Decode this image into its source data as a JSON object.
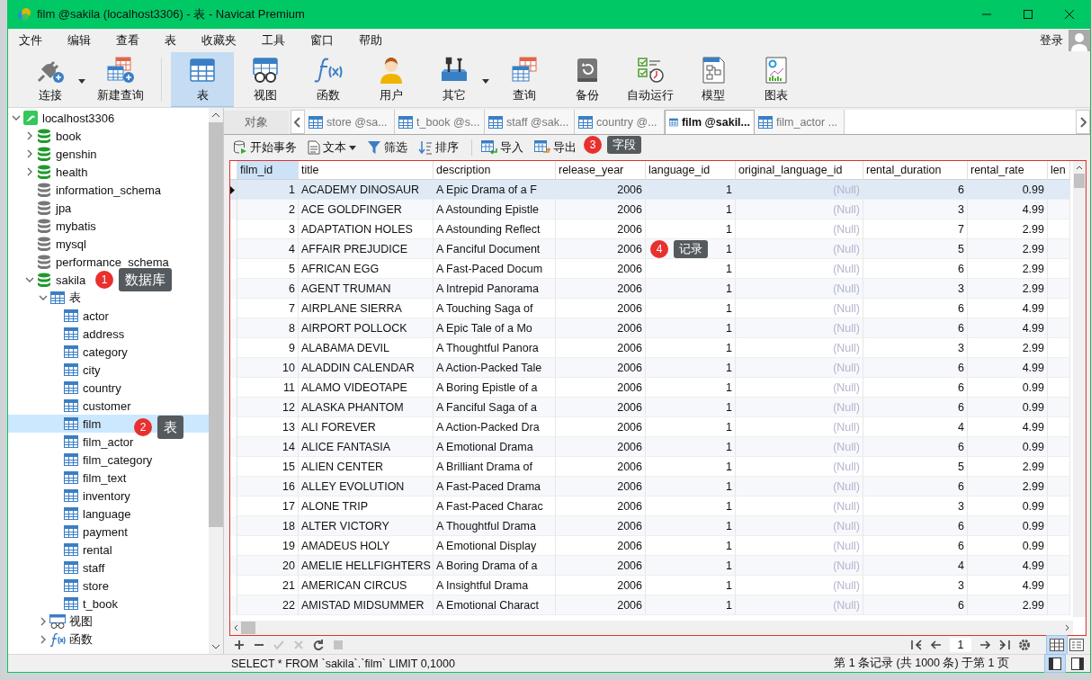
{
  "window": {
    "title": "film @sakila (localhost3306) - 表 - Navicat Premium"
  },
  "menu": [
    "文件",
    "编辑",
    "查看",
    "表",
    "收藏夹",
    "工具",
    "窗口",
    "帮助"
  ],
  "login": "登录",
  "toolbar": [
    {
      "label": "连接",
      "dropdown": true,
      "selected": false
    },
    {
      "label": "新建查询",
      "dropdown": false,
      "selected": false
    },
    {
      "label": "表",
      "dropdown": false,
      "selected": true
    },
    {
      "label": "视图",
      "dropdown": false,
      "selected": false
    },
    {
      "label": "函数",
      "dropdown": false,
      "selected": false
    },
    {
      "label": "用户",
      "dropdown": false,
      "selected": false
    },
    {
      "label": "其它",
      "dropdown": true,
      "selected": false
    },
    {
      "label": "查询",
      "dropdown": false,
      "selected": false
    },
    {
      "label": "备份",
      "dropdown": false,
      "selected": false
    },
    {
      "label": "自动运行",
      "dropdown": false,
      "selected": false
    },
    {
      "label": "模型",
      "dropdown": false,
      "selected": false
    },
    {
      "label": "图表",
      "dropdown": false,
      "selected": false
    }
  ],
  "tree": [
    {
      "label": "localhost3306",
      "kind": "connection",
      "expanded": true,
      "selected": false,
      "children": [
        {
          "label": "book",
          "kind": "database",
          "connected": true,
          "expanded": false,
          "selected": false
        },
        {
          "label": "genshin",
          "kind": "database",
          "connected": true,
          "expanded": false,
          "selected": false
        },
        {
          "label": "health",
          "kind": "database",
          "connected": true,
          "expanded": false,
          "selected": false
        },
        {
          "label": "information_schema",
          "kind": "database",
          "connected": false,
          "selected": false
        },
        {
          "label": "jpa",
          "kind": "database",
          "connected": false,
          "selected": false
        },
        {
          "label": "mybatis",
          "kind": "database",
          "connected": false,
          "selected": false
        },
        {
          "label": "mysql",
          "kind": "database",
          "connected": false,
          "selected": false
        },
        {
          "label": "performance_schema",
          "kind": "database",
          "connected": false,
          "selected": false
        },
        {
          "label": "sakila",
          "kind": "database",
          "connected": true,
          "expanded": true,
          "selected": false,
          "children": [
            {
              "label": "表",
              "kind": "tables",
              "expanded": true,
              "selected": false,
              "children": [
                {
                  "label": "actor",
                  "kind": "table",
                  "selected": false
                },
                {
                  "label": "address",
                  "kind": "table",
                  "selected": false
                },
                {
                  "label": "category",
                  "kind": "table",
                  "selected": false
                },
                {
                  "label": "city",
                  "kind": "table",
                  "selected": false
                },
                {
                  "label": "country",
                  "kind": "table",
                  "selected": false
                },
                {
                  "label": "customer",
                  "kind": "table",
                  "selected": false
                },
                {
                  "label": "film",
                  "kind": "table",
                  "selected": true
                },
                {
                  "label": "film_actor",
                  "kind": "table",
                  "selected": false
                },
                {
                  "label": "film_category",
                  "kind": "table",
                  "selected": false
                },
                {
                  "label": "film_text",
                  "kind": "table",
                  "selected": false
                },
                {
                  "label": "inventory",
                  "kind": "table",
                  "selected": false
                },
                {
                  "label": "language",
                  "kind": "table",
                  "selected": false
                },
                {
                  "label": "payment",
                  "kind": "table",
                  "selected": false
                },
                {
                  "label": "rental",
                  "kind": "table",
                  "selected": false
                },
                {
                  "label": "staff",
                  "kind": "table",
                  "selected": false
                },
                {
                  "label": "store",
                  "kind": "table",
                  "selected": false
                },
                {
                  "label": "t_book",
                  "kind": "table",
                  "selected": false
                }
              ]
            },
            {
              "label": "视图",
              "kind": "views",
              "expanded": false,
              "selected": false
            },
            {
              "label": "函数",
              "kind": "functions",
              "expanded": false,
              "selected": false
            }
          ]
        }
      ]
    }
  ],
  "objects_tab": {
    "label": "对象"
  },
  "tabs": [
    {
      "label": "store @sa...",
      "selected": false
    },
    {
      "label": "t_book @s...",
      "selected": false
    },
    {
      "label": "staff @sak...",
      "selected": false
    },
    {
      "label": "country @...",
      "selected": false
    },
    {
      "label": "film @sakil...",
      "selected": true
    },
    {
      "label": "film_actor ...",
      "selected": false
    }
  ],
  "actions": [
    {
      "label": "开始事务",
      "dropdown": false
    },
    {
      "label": "文本",
      "dropdown": true
    },
    {
      "label": "筛选",
      "dropdown": false
    },
    {
      "label": "排序",
      "dropdown": false
    },
    {
      "label": "导入",
      "dropdown": false
    },
    {
      "label": "导出",
      "dropdown": false
    }
  ],
  "table": {
    "columns": [
      {
        "label": "film_id",
        "kind": "number",
        "selected": true
      },
      {
        "label": "title",
        "kind": "text",
        "selected": false
      },
      {
        "label": "description",
        "kind": "text",
        "selected": false
      },
      {
        "label": "release_year",
        "kind": "number",
        "selected": false
      },
      {
        "label": "language_id",
        "kind": "number",
        "selected": false
      },
      {
        "label": "original_language_id",
        "kind": "null",
        "selected": false
      },
      {
        "label": "rental_duration",
        "kind": "number",
        "selected": false
      },
      {
        "label": "rental_rate",
        "kind": "number",
        "selected": false
      },
      {
        "label": "len",
        "kind": "number",
        "selected": false
      }
    ],
    "rows": [
      {
        "selected": true,
        "cells": [
          "1",
          "ACADEMY DINOSAUR",
          "A Epic Drama of a F",
          "2006",
          "1",
          "(Null)",
          "6",
          "0.99"
        ]
      },
      {
        "selected": false,
        "cells": [
          "2",
          "ACE GOLDFINGER",
          "A Astounding Epistle",
          "2006",
          "1",
          "(Null)",
          "3",
          "4.99"
        ]
      },
      {
        "selected": false,
        "cells": [
          "3",
          "ADAPTATION HOLES",
          "A Astounding Reflect",
          "2006",
          "1",
          "(Null)",
          "7",
          "2.99"
        ]
      },
      {
        "selected": false,
        "cells": [
          "4",
          "AFFAIR PREJUDICE",
          "A Fanciful Document",
          "2006",
          "1",
          "(Null)",
          "5",
          "2.99"
        ]
      },
      {
        "selected": false,
        "cells": [
          "5",
          "AFRICAN EGG",
          "A Fast-Paced Docum",
          "2006",
          "1",
          "(Null)",
          "6",
          "2.99"
        ]
      },
      {
        "selected": false,
        "cells": [
          "6",
          "AGENT TRUMAN",
          "A Intrepid Panorama",
          "2006",
          "1",
          "(Null)",
          "3",
          "2.99"
        ]
      },
      {
        "selected": false,
        "cells": [
          "7",
          "AIRPLANE SIERRA",
          "A Touching Saga of",
          "2006",
          "1",
          "(Null)",
          "6",
          "4.99"
        ]
      },
      {
        "selected": false,
        "cells": [
          "8",
          "AIRPORT POLLOCK",
          "A Epic Tale of a Mo",
          "2006",
          "1",
          "(Null)",
          "6",
          "4.99"
        ]
      },
      {
        "selected": false,
        "cells": [
          "9",
          "ALABAMA DEVIL",
          "A Thoughtful Panora",
          "2006",
          "1",
          "(Null)",
          "3",
          "2.99"
        ]
      },
      {
        "selected": false,
        "cells": [
          "10",
          "ALADDIN CALENDAR",
          "A Action-Packed Tale",
          "2006",
          "1",
          "(Null)",
          "6",
          "4.99"
        ]
      },
      {
        "selected": false,
        "cells": [
          "11",
          "ALAMO VIDEOTAPE",
          "A Boring Epistle of a",
          "2006",
          "1",
          "(Null)",
          "6",
          "0.99"
        ]
      },
      {
        "selected": false,
        "cells": [
          "12",
          "ALASKA PHANTOM",
          "A Fanciful Saga of a",
          "2006",
          "1",
          "(Null)",
          "6",
          "0.99"
        ]
      },
      {
        "selected": false,
        "cells": [
          "13",
          "ALI FOREVER",
          "A Action-Packed Dra",
          "2006",
          "1",
          "(Null)",
          "4",
          "4.99"
        ]
      },
      {
        "selected": false,
        "cells": [
          "14",
          "ALICE FANTASIA",
          "A Emotional Drama",
          "2006",
          "1",
          "(Null)",
          "6",
          "0.99"
        ]
      },
      {
        "selected": false,
        "cells": [
          "15",
          "ALIEN CENTER",
          "A Brilliant Drama of",
          "2006",
          "1",
          "(Null)",
          "5",
          "2.99"
        ]
      },
      {
        "selected": false,
        "cells": [
          "16",
          "ALLEY EVOLUTION",
          "A Fast-Paced Drama",
          "2006",
          "1",
          "(Null)",
          "6",
          "2.99"
        ]
      },
      {
        "selected": false,
        "cells": [
          "17",
          "ALONE TRIP",
          "A Fast-Paced Charac",
          "2006",
          "1",
          "(Null)",
          "3",
          "0.99"
        ]
      },
      {
        "selected": false,
        "cells": [
          "18",
          "ALTER VICTORY",
          "A Thoughtful Drama",
          "2006",
          "1",
          "(Null)",
          "6",
          "0.99"
        ]
      },
      {
        "selected": false,
        "cells": [
          "19",
          "AMADEUS HOLY",
          "A Emotional Display",
          "2006",
          "1",
          "(Null)",
          "6",
          "0.99"
        ]
      },
      {
        "selected": false,
        "cells": [
          "20",
          "AMELIE HELLFIGHTERS",
          "A Boring Drama of a",
          "2006",
          "1",
          "(Null)",
          "4",
          "4.99"
        ]
      },
      {
        "selected": false,
        "cells": [
          "21",
          "AMERICAN CIRCUS",
          "A Insightful Drama",
          "2006",
          "1",
          "(Null)",
          "3",
          "4.99"
        ]
      },
      {
        "selected": false,
        "cells": [
          "22",
          "AMISTAD MIDSUMMER",
          "A Emotional Charact",
          "2006",
          "1",
          "(Null)",
          "6",
          "2.99"
        ]
      }
    ]
  },
  "record_buttons": [
    {
      "disabled": false
    },
    {
      "disabled": false
    },
    {
      "disabled": true
    },
    {
      "disabled": true
    },
    {
      "disabled": false
    },
    {
      "disabled": true
    }
  ],
  "pager": {
    "page": "1"
  },
  "view_modes": [
    {
      "selected": true
    },
    {
      "selected": false
    }
  ],
  "status_bar": {
    "sql": "SELECT * FROM `sakila`.`film` LIMIT 0,1000",
    "record_info": "第 1 条记录 (共 1000 条) 于第 1 页",
    "panels": [
      {
        "selected": true
      },
      {
        "selected": false
      }
    ]
  },
  "callouts": [
    {
      "number": "1",
      "label": "数据库"
    },
    {
      "number": "2",
      "label": "表"
    },
    {
      "number": "3",
      "label": "字段"
    },
    {
      "number": "4",
      "label": "记录"
    }
  ]
}
